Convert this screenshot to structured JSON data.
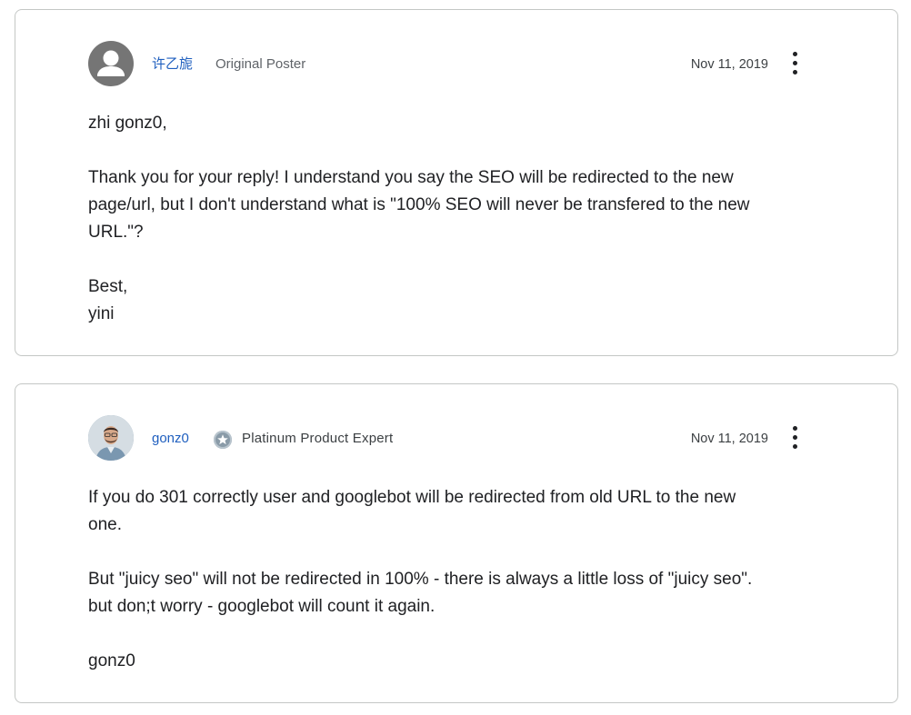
{
  "posts": [
    {
      "author": "许乙旎",
      "role": "Original Poster",
      "date": "Nov 11, 2019",
      "avatar_icon": "person-placeholder-icon",
      "paragraphs": [
        [
          "zhi gonz0,"
        ],
        [
          "Thank you for your reply! I understand you say the SEO will be redirected to the new",
          "page/url, but I don't understand what is \"100% SEO will never be transfered to the new",
          "URL.\"?"
        ],
        [
          "Best,",
          "yini"
        ]
      ]
    },
    {
      "author": "gonz0",
      "role": "Platinum Product Expert",
      "date": "Nov 11, 2019",
      "avatar_icon": "user-photo-avatar",
      "badge_icon": "platinum-star-badge-icon",
      "paragraphs": [
        [
          "If you do 301 correctly user and googlebot will be redirected from old URL to the new",
          "one."
        ],
        [
          "But \"juicy seo\" will not be redirected in 100% - there is always a little loss of \"juicy seo\".",
          "but don;t worry - googlebot will count it again."
        ],
        [
          "gonz0"
        ]
      ]
    }
  ],
  "colors": {
    "author_link": "#1f5fbf",
    "card_border": "#c4c7c5",
    "text": "#202124",
    "muted": "#5f6368"
  }
}
